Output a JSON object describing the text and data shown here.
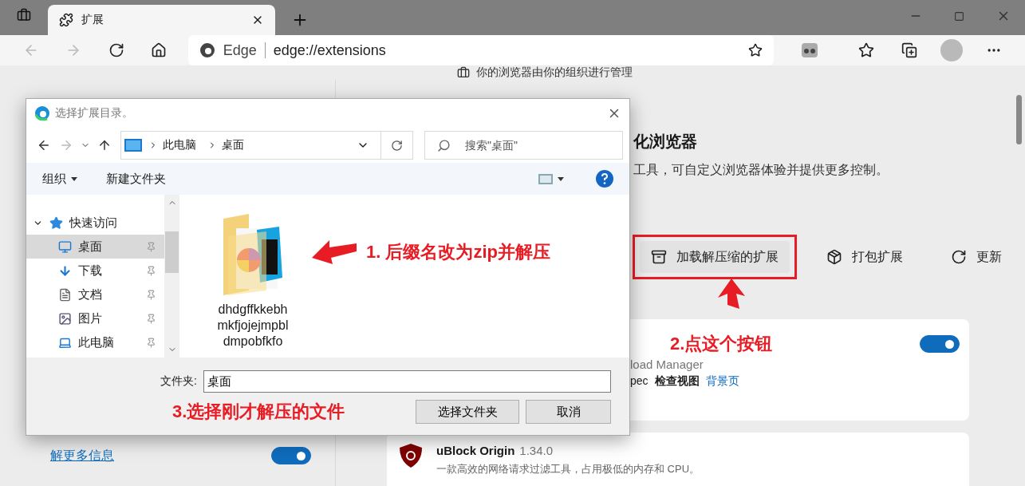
{
  "browser": {
    "tabs": [
      {
        "title": "扩展",
        "selected": true
      }
    ],
    "address": {
      "site": "Edge",
      "url": "edge://extensions"
    }
  },
  "banner": {
    "text": "你的浏览器由你的组织进行管理"
  },
  "sidebar": {
    "link": "解更多信息",
    "toggle": {
      "on": true
    }
  },
  "header": {
    "title": "化浏览器",
    "subtitle": "工具，可自定义浏览器体验并提供更多控制。"
  },
  "actions": [
    {
      "kind": "load",
      "label": "加载解压缩的扩展",
      "highlighted": true
    },
    {
      "kind": "pack",
      "label": "打包扩展",
      "highlighted": false
    },
    {
      "kind": "update",
      "label": "更新",
      "highlighted": false
    }
  ],
  "extensions": [
    {
      "kind": "partial",
      "name": "load Manager",
      "annotation": "2.点这个按钮",
      "on": true,
      "links": [
        {
          "kind": "plain",
          "label": "pec"
        },
        {
          "kind": "bold",
          "label": "检查视图"
        },
        {
          "kind": "link",
          "label": "背景页"
        }
      ]
    },
    {
      "kind": "full",
      "name": "uBlock Origin",
      "version": "1.34.0",
      "description": "一款高效的网络请求过滤工具，占用极低的内存和 CPU。"
    }
  ],
  "dialog": {
    "title": "选择扩展目录。",
    "path": [
      "此电脑",
      "桌面"
    ],
    "search": {
      "placeholder": "搜索\"桌面\""
    },
    "commands": [
      {
        "label": "组织",
        "menu": true
      },
      {
        "label": "新建文件夹",
        "menu": false
      }
    ],
    "nav": [
      {
        "label": "快速访问",
        "kind": "quick",
        "expanded": true,
        "selected": false,
        "children": [
          {
            "label": "桌面",
            "kind": "desktop",
            "selected": true
          },
          {
            "label": "下载",
            "kind": "download",
            "selected": false
          },
          {
            "label": "文档",
            "kind": "documents",
            "selected": false
          },
          {
            "label": "图片",
            "kind": "pictures",
            "selected": false
          },
          {
            "label": "此电脑",
            "kind": "computer",
            "selected": false
          }
        ]
      }
    ],
    "files": [
      {
        "name": "dhdgffkkebhmkfjojejmpbldmpobfkfo"
      }
    ],
    "content_annotation": "1. 后缀名改为zip并解压",
    "folder_field": {
      "label": "文件夹:",
      "value": "桌面"
    },
    "footer_annotation": "3.选择刚才解压的文件",
    "buttons": [
      {
        "kind": "confirm",
        "label": "选择文件夹"
      },
      {
        "kind": "cancel",
        "label": "取消"
      }
    ]
  }
}
